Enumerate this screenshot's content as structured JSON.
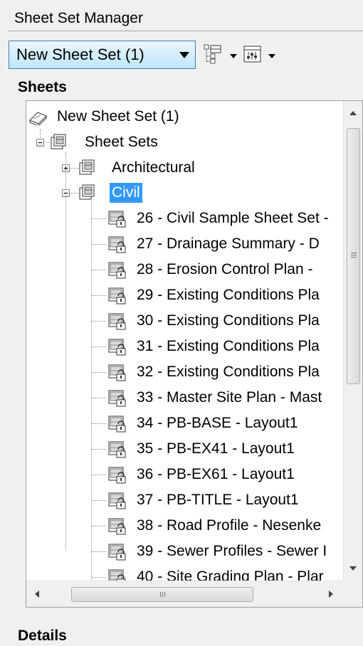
{
  "panel": {
    "title": "Sheet Set Manager"
  },
  "toolbar": {
    "combo_value": "New Sheet Set (1)"
  },
  "sections": {
    "sheets": "Sheets",
    "details": "Details"
  },
  "tree": {
    "root": "New Sheet Set (1)",
    "sheet_sets": "Sheet Sets",
    "architectural": "Architectural",
    "civil": "Civil",
    "sheets": [
      "26 - Civil Sample Sheet Set -",
      "27 - Drainage Summary - D",
      "28 - Erosion Control Plan -",
      "29 - Existing Conditions Pla",
      "30 - Existing Conditions Pla",
      "31 - Existing Conditions Pla",
      "32 - Existing Conditions Pla",
      "33 - Master Site Plan - Mast",
      "34 - PB-BASE - Layout1",
      "35 - PB-EX41 - Layout1",
      "36 - PB-EX61 - Layout1",
      "37 - PB-TITLE - Layout1",
      "38 - Road Profile - Nesenke",
      "39 - Sewer Profiles - Sewer I",
      "40 - Site Grading Plan - Plar"
    ]
  },
  "colors": {
    "selection": "#3399ff",
    "combo_border": "#3c7fb1"
  },
  "icons": [
    "sheet-set-icon",
    "subset-icon",
    "sheet-lock-icon",
    "layout-icon",
    "properties-icon"
  ]
}
